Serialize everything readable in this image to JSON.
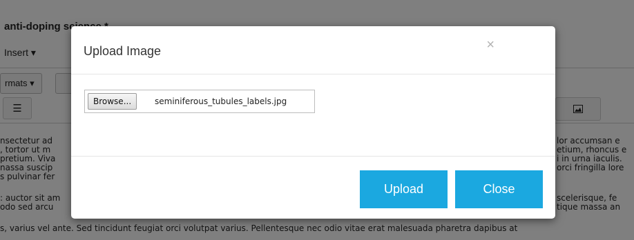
{
  "background": {
    "title": "anti-doping science *",
    "insert_menu": "Insert ▾",
    "formats_menu": "rmats ▾",
    "list_icon": "list-icon",
    "image_icon": "image-icon",
    "left_lines": [
      "nsectetur ad",
      ", tortor ut m",
      "pretium. Viva",
      "nassa suscip",
      "s pulvinar fer",
      "",
      ": auctor sit am",
      "odo sed arcu"
    ],
    "right_lines": [
      "lor accumsan e",
      "etium, rhoncus e",
      "i in urna iaculis.",
      "orci fringilla lore",
      "",
      "",
      "scelerisque, fe",
      "tique massa an"
    ],
    "bottom_line": "s, varius vel ante. Sed tincidunt feugiat orci volutpat varius. Pellentesque nec odio vitae erat malesuada pharetra dapibus at"
  },
  "modal": {
    "title": "Upload Image",
    "close_glyph": "×",
    "browse_label": "Browse...",
    "file_name": "seminiferous_tubules_labels.jpg",
    "upload_label": "Upload",
    "close_label": "Close"
  },
  "colors": {
    "accent": "#1ba8e0",
    "overlay": "rgba(0,0,0,0.5)"
  }
}
